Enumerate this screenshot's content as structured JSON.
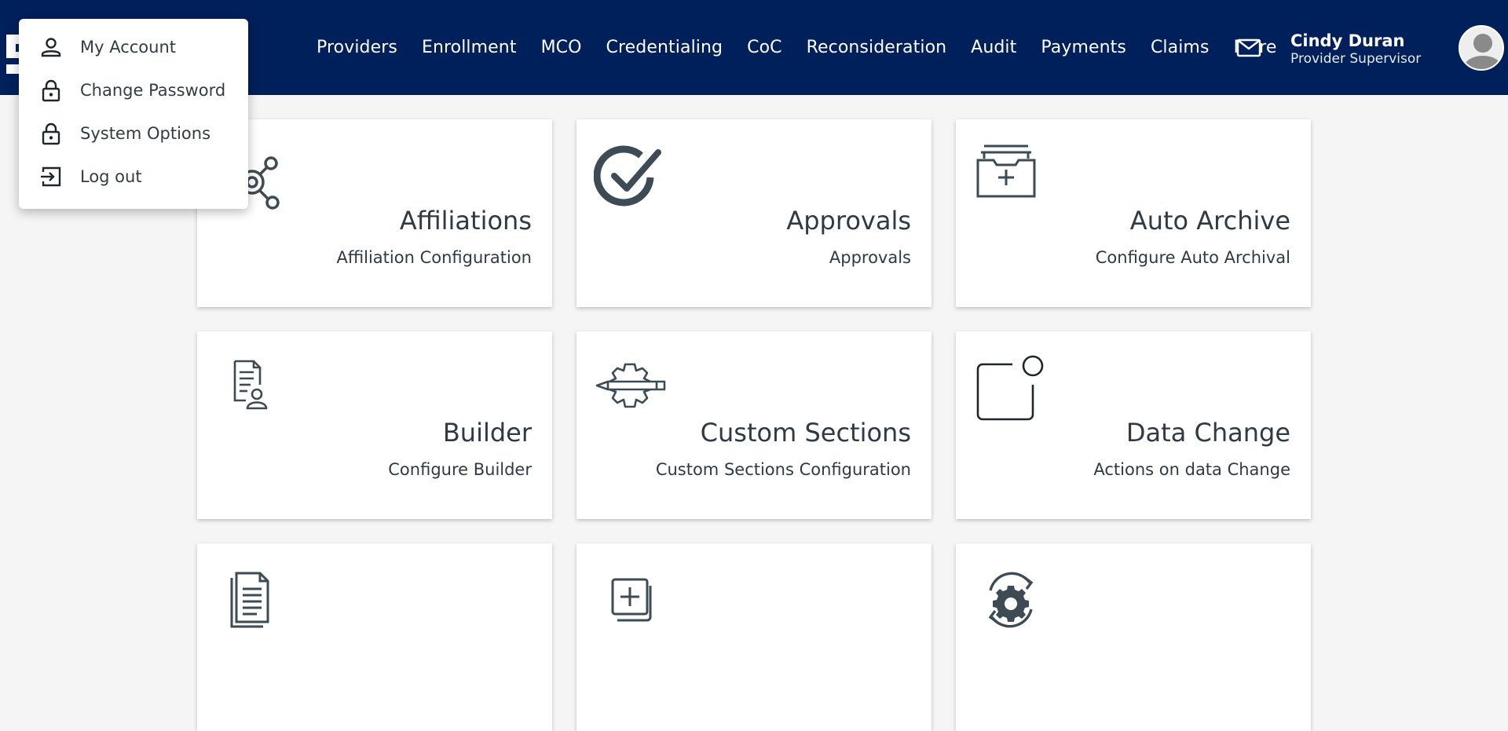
{
  "header": {
    "nav": [
      "Providers",
      "Enrollment",
      "MCO",
      "Credentialing",
      "CoC",
      "Reconsideration",
      "Audit",
      "Payments",
      "Claims",
      "More"
    ],
    "user": {
      "name": "Cindy Duran",
      "role": "Provider Supervisor"
    },
    "icons": {
      "mail": "mail-icon",
      "avatar": "avatar-icon"
    }
  },
  "menu": {
    "items": [
      {
        "label": "My Account",
        "icon": "person-icon"
      },
      {
        "label": "Change Password",
        "icon": "lock-icon"
      },
      {
        "label": "System Options",
        "icon": "lock-icon"
      },
      {
        "label": "Log out",
        "icon": "logout-icon"
      }
    ]
  },
  "cards": [
    {
      "title": "Affiliations",
      "subtitle": "Affiliation Configuration",
      "icon": "affiliations-icon"
    },
    {
      "title": "Approvals",
      "subtitle": "Approvals",
      "icon": "check-circle-icon"
    },
    {
      "title": "Auto Archive",
      "subtitle": "Configure Auto Archival",
      "icon": "archive-tray-icon"
    },
    {
      "title": "Builder",
      "subtitle": "Configure Builder",
      "icon": "document-user-icon"
    },
    {
      "title": "Custom Sections",
      "subtitle": "Custom Sections Configuration",
      "icon": "gear-pencil-icon"
    },
    {
      "title": "Data Change",
      "subtitle": "Actions on data Change",
      "icon": "notification-square-icon"
    },
    {
      "title": "",
      "subtitle": "",
      "icon": "documents-icon"
    },
    {
      "title": "",
      "subtitle": "",
      "icon": "add-copy-icon"
    },
    {
      "title": "",
      "subtitle": "",
      "icon": "gear-sync-icon"
    }
  ],
  "colors": {
    "header_bg": "#00205b",
    "icon_gray": "#3d4b55",
    "page_bg": "#f5f5f5"
  }
}
